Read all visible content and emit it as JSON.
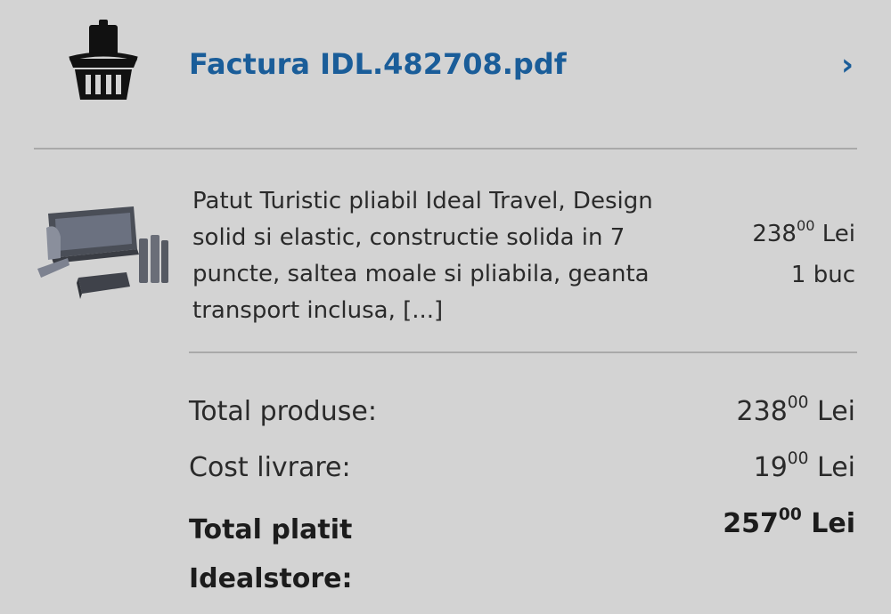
{
  "invoice": {
    "filename": "Factura IDL.482708.pdf",
    "chevron": "›",
    "icon": "basket-icon"
  },
  "product": {
    "image": "travel-cot-thumbnail",
    "description": "Patut Turistic pliabil Ideal Travel, Design solid si elastic, constructie solida in 7 puncte, saltea moale si pliabila, geanta transport inclusa, [...]",
    "price_int": "238",
    "price_dec": "00",
    "currency": "Lei",
    "quantity": "1 buc"
  },
  "totals": {
    "products_label": "Total produse:",
    "products_int": "238",
    "products_dec": "00",
    "delivery_label": "Cost livrare:",
    "delivery_int": "19",
    "delivery_dec": "00",
    "paid_label": "Total platit Idealstore:",
    "paid_int": "257",
    "paid_dec": "00",
    "currency": "Lei"
  },
  "colors": {
    "background": "#d3d3d3",
    "link": "#1a5d99",
    "divider": "#a9a9a9",
    "text": "#222222"
  }
}
